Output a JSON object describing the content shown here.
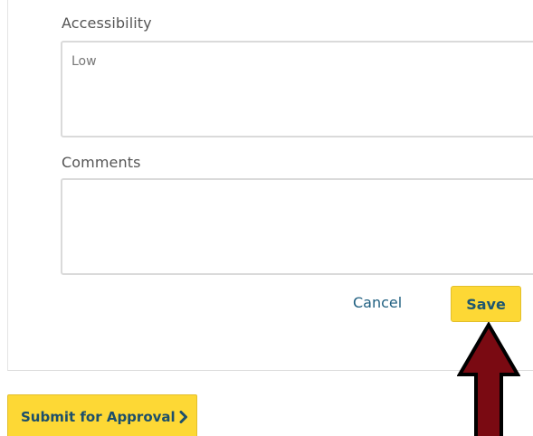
{
  "form": {
    "accessibility": {
      "label": "Accessibility",
      "value": "Low"
    },
    "comments": {
      "label": "Comments",
      "value": ""
    },
    "actions": {
      "cancel_label": "Cancel",
      "save_label": "Save"
    }
  },
  "footer": {
    "submit_label": "Submit for Approval"
  },
  "annotation": {
    "arrow_color": "#7a0a12",
    "icon": "up-arrow-icon"
  }
}
